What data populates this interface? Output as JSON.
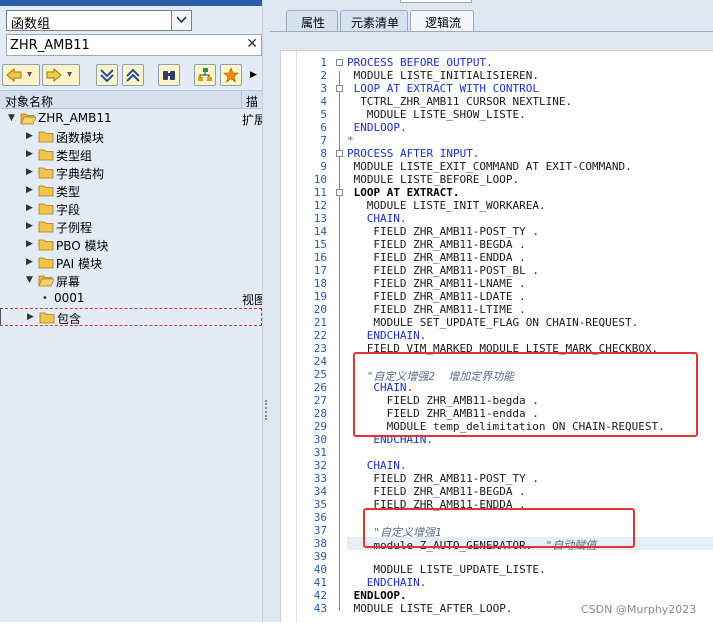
{
  "left": {
    "combo_value": "函数组",
    "search_value": "ZHR_AMB11",
    "clear_glyph": "✕",
    "tree_header": {
      "col1": "对象名称",
      "col2": "描"
    },
    "tree": [
      {
        "label": "ZHR_AMB11",
        "level": 0,
        "expanded": true,
        "folder": true,
        "extra": "扩展"
      },
      {
        "label": "函数模块",
        "level": 1,
        "expanded": false,
        "folder": true,
        "extra": ""
      },
      {
        "label": "类型组",
        "level": 1,
        "expanded": false,
        "folder": true,
        "extra": ""
      },
      {
        "label": "字典结构",
        "level": 1,
        "expanded": false,
        "folder": true,
        "extra": ""
      },
      {
        "label": "类型",
        "level": 1,
        "expanded": false,
        "folder": true,
        "extra": ""
      },
      {
        "label": "字段",
        "level": 1,
        "expanded": false,
        "folder": true,
        "extra": ""
      },
      {
        "label": "子例程",
        "level": 1,
        "expanded": false,
        "folder": true,
        "extra": ""
      },
      {
        "label": "PBO 模块",
        "level": 1,
        "expanded": false,
        "folder": true,
        "extra": ""
      },
      {
        "label": "PAI 模块",
        "level": 1,
        "expanded": false,
        "folder": true,
        "extra": ""
      },
      {
        "label": "屏幕",
        "level": 1,
        "expanded": true,
        "folder": true,
        "extra": ""
      },
      {
        "label": "0001",
        "level": 2,
        "expanded": false,
        "folder": false,
        "extra": "视图"
      },
      {
        "label": "包含",
        "level": 1,
        "expanded": false,
        "folder": true,
        "extra": ""
      }
    ]
  },
  "tabs": [
    {
      "label": "属性",
      "active": false
    },
    {
      "label": "元素清单",
      "active": false
    },
    {
      "label": "逻辑流",
      "active": true
    }
  ],
  "code": [
    {
      "n": "1",
      "t": "PROCESS BEFORE OUTPUT.",
      "kind": "kw",
      "indent": 0
    },
    {
      "n": "2",
      "t": "MODULE LISTE_INITIALISIEREN.",
      "kind": "mix",
      "indent": 1
    },
    {
      "n": "3",
      "t": "LOOP AT EXTRACT WITH CONTROL",
      "kind": "kw",
      "indent": 1
    },
    {
      "n": "4",
      "t": "TCTRL_ZHR_AMB11 CURSOR NEXTLINE.",
      "kind": "mix2",
      "indent": 2
    },
    {
      "n": "5",
      "t": "MODULE LISTE_SHOW_LISTE.",
      "kind": "mix",
      "indent": 3
    },
    {
      "n": "6",
      "t": "ENDLOOP.",
      "kind": "kw",
      "indent": 1
    },
    {
      "n": "7",
      "t": "*",
      "kind": "cm",
      "indent": 0
    },
    {
      "n": "8",
      "t": "PROCESS AFTER INPUT.",
      "kind": "kw",
      "indent": 0
    },
    {
      "n": "9",
      "t": "MODULE LISTE_EXIT_COMMAND AT EXIT-COMMAND.",
      "kind": "mix3",
      "indent": 1
    },
    {
      "n": "10",
      "t": "MODULE LISTE_BEFORE_LOOP.",
      "kind": "mix",
      "indent": 1
    },
    {
      "n": "11",
      "t": "LOOP AT EXTRACT.",
      "kind": "bold",
      "indent": 1
    },
    {
      "n": "12",
      "t": "MODULE LISTE_INIT_WORKAREA.",
      "kind": "mix",
      "indent": 3
    },
    {
      "n": "13",
      "t": "CHAIN.",
      "kind": "kw",
      "indent": 3
    },
    {
      "n": "14",
      "t": "FIELD ZHR_AMB11-POST_TY .",
      "kind": "mix",
      "indent": 4
    },
    {
      "n": "15",
      "t": "FIELD ZHR_AMB11-BEGDA .",
      "kind": "mix",
      "indent": 4
    },
    {
      "n": "16",
      "t": "FIELD ZHR_AMB11-ENDDA .",
      "kind": "mix",
      "indent": 4
    },
    {
      "n": "17",
      "t": "FIELD ZHR_AMB11-POST_BL .",
      "kind": "mix",
      "indent": 4
    },
    {
      "n": "18",
      "t": "FIELD ZHR_AMB11-LNAME .",
      "kind": "mix",
      "indent": 4
    },
    {
      "n": "19",
      "t": "FIELD ZHR_AMB11-LDATE .",
      "kind": "mix",
      "indent": 4
    },
    {
      "n": "20",
      "t": "FIELD ZHR_AMB11-LTIME .",
      "kind": "mix",
      "indent": 4
    },
    {
      "n": "21",
      "t": "MODULE SET_UPDATE_FLAG ON CHAIN-REQUEST.",
      "kind": "mix4",
      "indent": 4
    },
    {
      "n": "22",
      "t": "ENDCHAIN.",
      "kind": "kw",
      "indent": 3
    },
    {
      "n": "23",
      "t": "FIELD VIM_MARKED MODULE LISTE_MARK_CHECKBOX.",
      "kind": "mix5",
      "indent": 3
    },
    {
      "n": "24",
      "t": "",
      "kind": "plain",
      "indent": 0
    },
    {
      "n": "25",
      "t": "\"自定义增强2  增加定界功能",
      "kind": "cm",
      "indent": 3
    },
    {
      "n": "26",
      "t": "CHAIN.",
      "kind": "kw",
      "indent": 4
    },
    {
      "n": "27",
      "t": "FIELD ZHR_AMB11-begda .",
      "kind": "mix",
      "indent": 6
    },
    {
      "n": "28",
      "t": "FIELD ZHR_AMB11-endda .",
      "kind": "mix",
      "indent": 6
    },
    {
      "n": "29",
      "t": "MODULE temp_delimitation ON CHAIN-REQUEST.",
      "kind": "mix4",
      "indent": 6
    },
    {
      "n": "30",
      "t": "ENDCHAIN.",
      "kind": "kw",
      "indent": 4
    },
    {
      "n": "31",
      "t": "",
      "kind": "plain",
      "indent": 0
    },
    {
      "n": "32",
      "t": "CHAIN.",
      "kind": "kw",
      "indent": 3
    },
    {
      "n": "33",
      "t": "FIELD ZHR_AMB11-POST_TY .",
      "kind": "mix",
      "indent": 4
    },
    {
      "n": "34",
      "t": "FIELD ZHR_AMB11-BEGDA .",
      "kind": "mix",
      "indent": 4
    },
    {
      "n": "35",
      "t": "FIELD ZHR_AMB11-ENDDA .",
      "kind": "mix",
      "indent": 4
    },
    {
      "n": "36",
      "t": "",
      "kind": "plain",
      "indent": 0
    },
    {
      "n": "37",
      "t": "\"自定义增强1",
      "kind": "cm",
      "indent": 4
    },
    {
      "n": "38",
      "t": "module Z_AUTO_GENERATOR.",
      "kind": "mix",
      "indent": 4,
      "tail": "  \"自动赋值"
    },
    {
      "n": "39",
      "t": "",
      "kind": "plain",
      "indent": 0
    },
    {
      "n": "40",
      "t": "MODULE LISTE_UPDATE_LISTE.",
      "kind": "mix",
      "indent": 4
    },
    {
      "n": "41",
      "t": "ENDCHAIN.",
      "kind": "kw",
      "indent": 3
    },
    {
      "n": "42",
      "t": "ENDLOOP.",
      "kind": "bold",
      "indent": 1
    },
    {
      "n": "43",
      "t": "MODULE LISTE_AFTER_LOOP.",
      "kind": "mix",
      "indent": 1
    }
  ],
  "watermark": "CSDN @Murphy2023",
  "colors": {
    "keyword": "#1b2fd2",
    "comment": "#5a6b88",
    "highlight_box": "#e33434"
  }
}
